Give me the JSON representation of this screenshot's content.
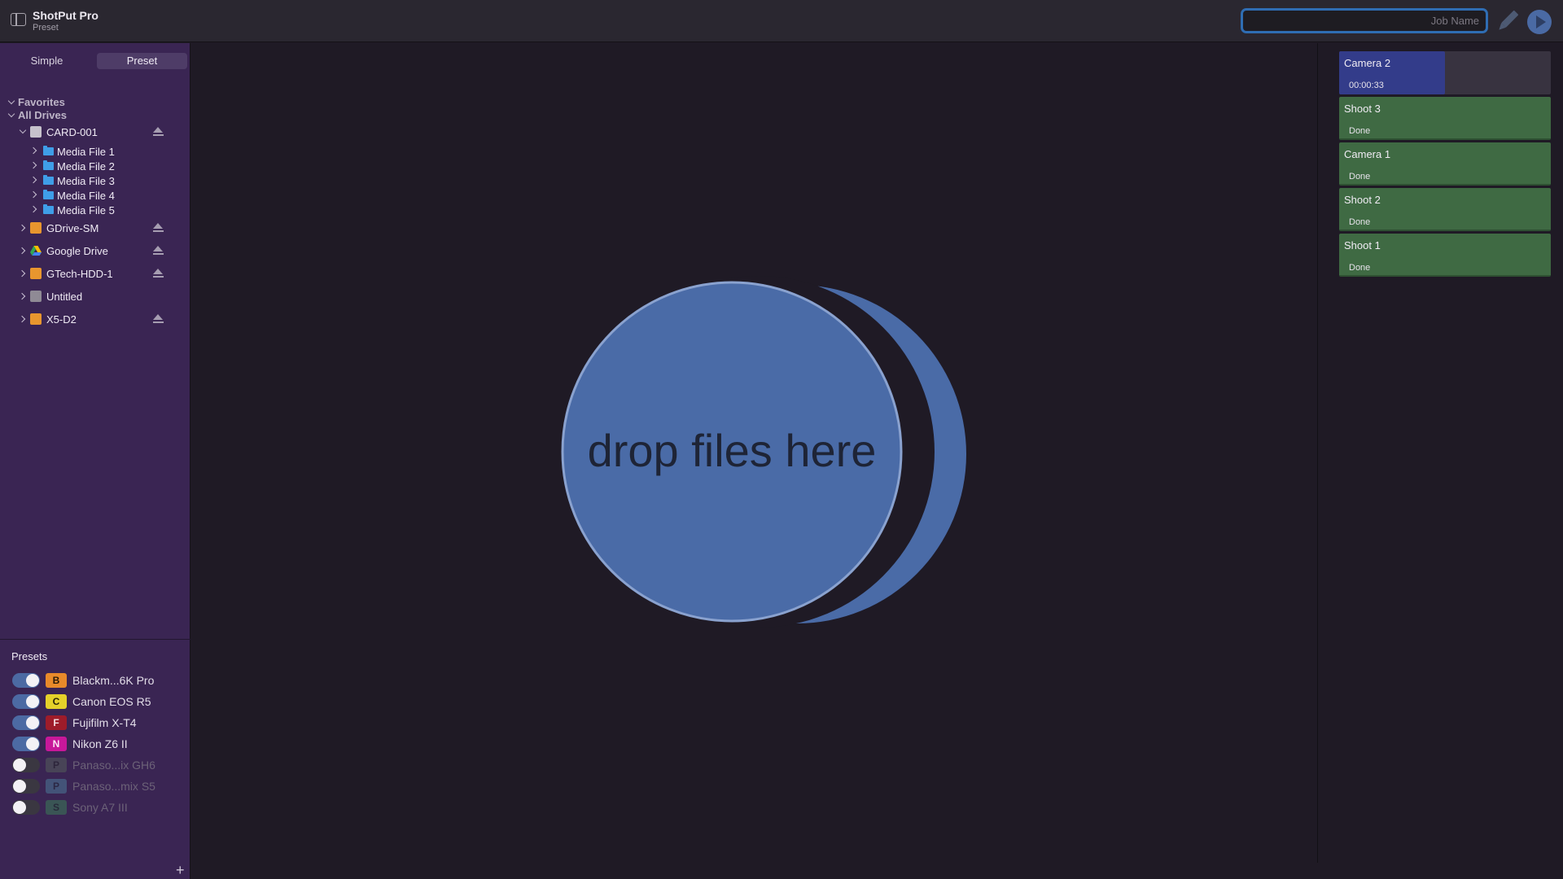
{
  "titlebar": {
    "app_name": "ShotPut Pro",
    "subtitle": "Preset",
    "job_name_placeholder": "Job Name"
  },
  "sidebar": {
    "tabs": [
      {
        "label": "Simple",
        "active": false
      },
      {
        "label": "Preset",
        "active": true
      }
    ],
    "favorites_label": "Favorites",
    "all_drives_label": "All Drives",
    "drives": [
      {
        "name": "CARD-001",
        "icon": "drive-icon",
        "icon_color": "#c7c2cc",
        "expanded": true,
        "eject": true,
        "children": [
          "Media File 1",
          "Media File 2",
          "Media File 3",
          "Media File 4",
          "Media File 5"
        ]
      },
      {
        "name": "GDrive-SM",
        "icon": "external-drive-icon",
        "icon_color": "#e8962e",
        "expanded": false,
        "eject": true
      },
      {
        "name": "Google Drive",
        "icon": "google-drive-icon",
        "icon_color": "#34a853",
        "expanded": false,
        "eject": true
      },
      {
        "name": "GTech-HDD-1",
        "icon": "external-drive-icon",
        "icon_color": "#e8962e",
        "expanded": false,
        "eject": true
      },
      {
        "name": "Untitled",
        "icon": "drive-icon",
        "icon_color": "#8f8a95",
        "expanded": false,
        "eject": false
      },
      {
        "name": "X5-D2",
        "icon": "external-drive-icon",
        "icon_color": "#e8962e",
        "expanded": false,
        "eject": true
      }
    ]
  },
  "presets": {
    "title": "Presets",
    "add_label": "+",
    "items": [
      {
        "badge": "B",
        "badge_bg": "#e88a2a",
        "badge_fg": "#2a1a08",
        "label": "Blackm...6K Pro",
        "enabled": true
      },
      {
        "badge": "C",
        "badge_bg": "#e5d12a",
        "badge_fg": "#2a2408",
        "label": "Canon EOS R5",
        "enabled": true
      },
      {
        "badge": "F",
        "badge_bg": "#9e1c2a",
        "badge_fg": "#f4dfe2",
        "label": "Fujifilm X-T4",
        "enabled": true
      },
      {
        "badge": "N",
        "badge_bg": "#c8189a",
        "badge_fg": "#fbe3f4",
        "label": "Nikon Z6 II",
        "enabled": true
      },
      {
        "badge": "P",
        "badge_bg": "#5a6a5c",
        "badge_fg": "#1e2620",
        "label": "Panaso...ix GH6",
        "enabled": false
      },
      {
        "badge": "P",
        "badge_bg": "#4f8ca6",
        "badge_fg": "#1a2a33",
        "label": "Panaso...mix S5",
        "enabled": false
      },
      {
        "badge": "S",
        "badge_bg": "#3c8f58",
        "badge_fg": "#12301c",
        "label": "Sony A7 III",
        "enabled": false
      }
    ]
  },
  "drop_zone": {
    "label": "drop files here",
    "circle_color": "#4a6ba7"
  },
  "jobs": [
    {
      "name": "Camera 2",
      "status": "00:00:33",
      "state": "in-progress",
      "progress": 0.5
    },
    {
      "name": "Shoot 3",
      "status": "Done",
      "state": "done"
    },
    {
      "name": "Camera 1",
      "status": "Done",
      "state": "done"
    },
    {
      "name": "Shoot 2",
      "status": "Done",
      "state": "done"
    },
    {
      "name": "Shoot 1",
      "status": "Done",
      "state": "done"
    }
  ]
}
